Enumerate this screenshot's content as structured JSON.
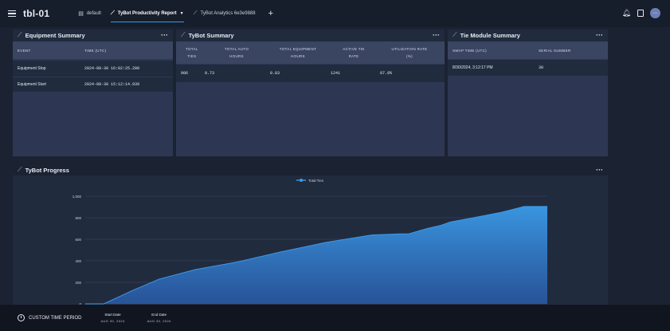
{
  "app": {
    "title": "tbl-01"
  },
  "tabs": [
    {
      "label": "default",
      "icon": "dashboard-icon"
    },
    {
      "label": "TyBot Productivity Report",
      "icon": "chart-line-icon"
    },
    {
      "label": "TyBot Analytics 6e3e9888",
      "icon": "chart-line-icon"
    }
  ],
  "equipment": {
    "title": "Equipment Summary",
    "columns": [
      "EVENT",
      "TIME (UTC)"
    ],
    "rows": [
      {
        "event": "Equipment Stop",
        "time": "2024-08-30 16:02:25.200"
      },
      {
        "event": "Equipment Start",
        "time": "2024-08-30 15:12:14.939"
      }
    ]
  },
  "tybot_summary": {
    "title": "TyBot Summary",
    "columns": [
      [
        "TOTAL",
        "TIES"
      ],
      [
        "TOTAL AUTO",
        "HOURS"
      ],
      [
        "TOTAL EQUIPMENT",
        "HOURS"
      ],
      [
        "ACTIVE TIE",
        "RATE"
      ],
      [
        "UTILIZATION RATE",
        "(%)"
      ]
    ],
    "row": [
      "906",
      "0.73",
      "0.83",
      "1241",
      "87.9%"
    ]
  },
  "tie_module": {
    "title": "Tie Module Summary",
    "columns": [
      "SWAP TIME (UTC)",
      "SERIAL NUMBER"
    ],
    "rows": [
      {
        "swap_time": "8/30/2024, 3:12:17 PM",
        "serial": "38"
      }
    ]
  },
  "progress": {
    "title": "TyBot Progress"
  },
  "chart_data": {
    "type": "area",
    "legend": [
      "Total Ties"
    ],
    "legend_position": "top-center",
    "ylim": [
      0,
      1000
    ],
    "yticks": [
      "0",
      "200",
      "400",
      "600",
      "800",
      "1,000"
    ],
    "series": [
      {
        "name": "Total Ties",
        "x": [
          0,
          0.04,
          0.07,
          0.1,
          0.16,
          0.24,
          0.33,
          0.42,
          0.52,
          0.62,
          0.68,
          0.7,
          0.74,
          0.77,
          0.79,
          0.84,
          0.9,
          0.95,
          1.0
        ],
        "values": [
          0,
          0,
          60,
          120,
          230,
          320,
          390,
          480,
          570,
          640,
          650,
          650,
          700,
          730,
          760,
          800,
          850,
          905,
          905
        ]
      }
    ],
    "grid": true,
    "color": "#3a9be8"
  },
  "footer": {
    "custom_label": "CUSTOM TIME PERIOD",
    "start_label": "Start Date",
    "start_value": "AUG 30, 2024",
    "end_label": "End Date",
    "end_value": "AUG 30, 2024"
  }
}
